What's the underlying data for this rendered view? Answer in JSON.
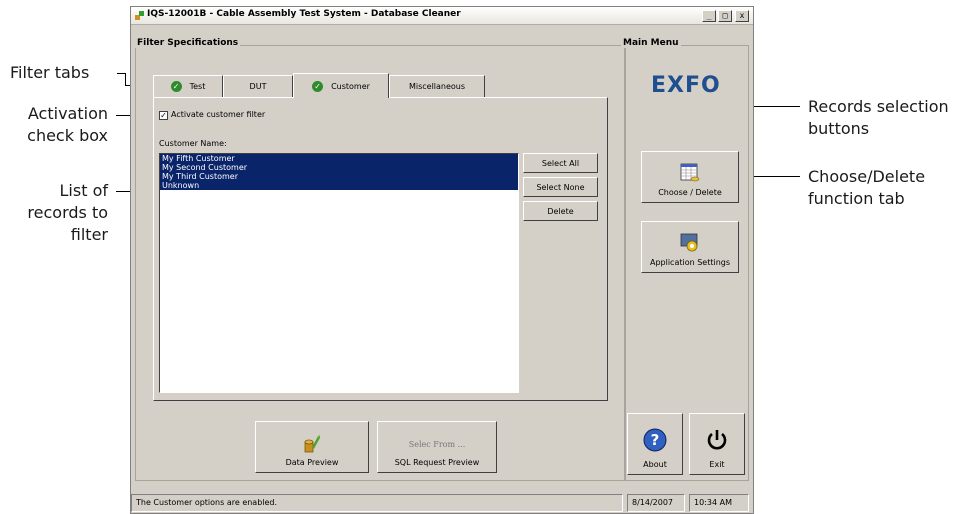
{
  "window": {
    "title": "IQS-12001B - Cable Assembly Test System - Database Cleaner",
    "controls": [
      "_",
      "□",
      "x"
    ]
  },
  "filter_group": {
    "title": "Filter Specifications",
    "tabs": [
      {
        "label": "Test",
        "checked": true
      },
      {
        "label": "DUT",
        "checked": false
      },
      {
        "label": "Customer",
        "checked": true,
        "active": true
      },
      {
        "label": "Miscellaneous",
        "checked": false
      }
    ],
    "activate_checkbox": {
      "label": "Activate customer filter",
      "checked": true
    },
    "list_label": "Customer Name:",
    "records": [
      "My Fifth Customer",
      "My Second Customer",
      "My Third Customer",
      "Unknown"
    ],
    "select_all": "Select All",
    "select_none": "Select None",
    "delete": "Delete"
  },
  "bottom_buttons": {
    "data_preview": "Data Preview",
    "sql_preview": "SQL Request Preview",
    "sql_icon_text": "Selec From ..."
  },
  "main_menu": {
    "title": "Main Menu",
    "logo": "EXFO",
    "choose_delete": "Choose / Delete",
    "app_settings": "Application Settings",
    "about": "About",
    "exit": "Exit"
  },
  "statusbar": {
    "message": "The Customer options are enabled.",
    "date": "8/14/2007",
    "time": "10:34 AM"
  },
  "callouts": {
    "filter_tabs": "Filter tabs",
    "activation_1": "Activation",
    "activation_2": "check box",
    "list_1": "List of",
    "list_2": "records to",
    "list_3": "filter",
    "records_sel_1": "Records selection",
    "records_sel_2": "buttons",
    "choose_delete_1": "Choose/Delete",
    "choose_delete_2": "function tab"
  },
  "colors": {
    "window_bg": "#d4d0c8",
    "selection": "#0a246a",
    "exfo_logo": "#1f4f8f",
    "check_green": "#2e8b2e"
  }
}
